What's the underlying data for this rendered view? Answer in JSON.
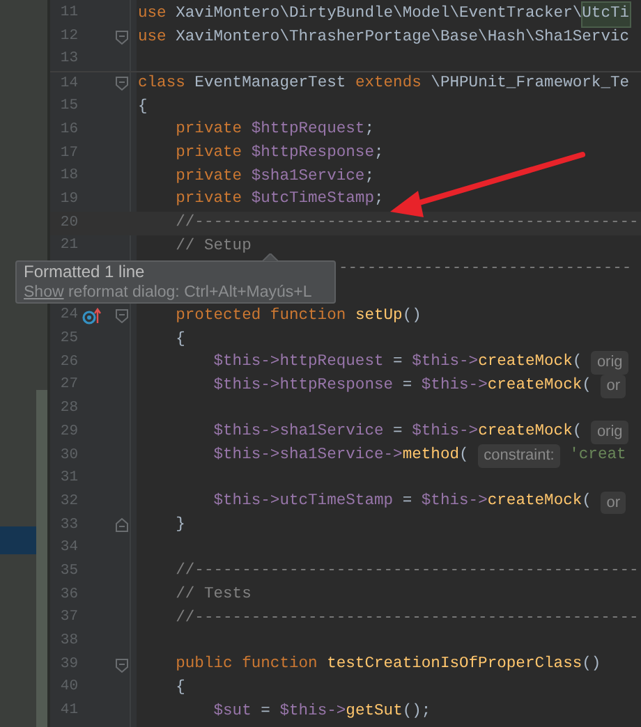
{
  "editor": {
    "lines": [
      {
        "number": "11",
        "segments": [
          {
            "text": "use",
            "kind": "keyword"
          },
          {
            "text": " XaviMontero\\DirtyBundle\\Model\\EventTracker\\",
            "kind": "plain"
          },
          {
            "text": "UtcTi",
            "kind": "usage"
          }
        ]
      },
      {
        "number": "12",
        "fold_start": true,
        "segments": [
          {
            "text": "use",
            "kind": "keyword"
          },
          {
            "text": " XaviMontero\\ThrasherPortage\\Base\\Hash\\Sha1Servic",
            "kind": "plain"
          }
        ]
      },
      {
        "number": "13",
        "separator": true
      },
      {
        "number": "14",
        "fold_start": true,
        "segments": [
          {
            "text": "class",
            "kind": "keyword"
          },
          {
            "text": " EventManagerTest ",
            "kind": "plain"
          },
          {
            "text": "extends",
            "kind": "keyword"
          },
          {
            "text": " \\PHPUnit_Framework_Te",
            "kind": "plain"
          }
        ]
      },
      {
        "number": "15",
        "segments": [
          {
            "text": "{",
            "kind": "plain"
          }
        ]
      },
      {
        "number": "16",
        "segments": [
          {
            "text": "    private",
            "kind": "keyword"
          },
          {
            "text": " $httpRequest",
            "kind": "variable"
          },
          {
            "text": ";",
            "kind": "plain"
          }
        ]
      },
      {
        "number": "17",
        "segments": [
          {
            "text": "    private",
            "kind": "keyword"
          },
          {
            "text": " $httpResponse",
            "kind": "variable"
          },
          {
            "text": ";",
            "kind": "plain"
          }
        ]
      },
      {
        "number": "18",
        "segments": [
          {
            "text": "    private",
            "kind": "keyword"
          },
          {
            "text": " $sha1Service",
            "kind": "variable"
          },
          {
            "text": ";",
            "kind": "plain"
          }
        ]
      },
      {
        "number": "19",
        "segments": [
          {
            "text": "    private",
            "kind": "keyword"
          },
          {
            "text": " $utcTimeStamp",
            "kind": "variable"
          },
          {
            "text": ";",
            "kind": "plain"
          }
        ]
      },
      {
        "number": "20",
        "current": true,
        "segments": [
          {
            "text": "    //-----------------------------------------------",
            "kind": "comment"
          }
        ]
      },
      {
        "number": "21",
        "segments": [
          {
            "text": "    // Setup",
            "kind": "comment"
          }
        ]
      },
      {
        "segments": [
          {
            "text": "-------------------------------",
            "kind": "comment"
          }
        ]
      },
      {
        "number": "24",
        "override": true,
        "fold_start": true,
        "segments": [
          {
            "text": "    protected function ",
            "kind": "keyword"
          },
          {
            "text": "setUp",
            "kind": "function"
          },
          {
            "text": "()",
            "kind": "plain"
          }
        ]
      },
      {
        "number": "25",
        "segments": [
          {
            "text": "    {",
            "kind": "plain"
          }
        ]
      },
      {
        "number": "26",
        "segments": [
          {
            "text": "        $this->httpRequest",
            "kind": "variable"
          },
          {
            "text": " = ",
            "kind": "plain"
          },
          {
            "text": "$this->",
            "kind": "variable"
          },
          {
            "text": "createMock",
            "kind": "function"
          },
          {
            "text": "( ",
            "kind": "plain"
          },
          {
            "text": "orig",
            "kind": "hint"
          }
        ]
      },
      {
        "number": "27",
        "segments": [
          {
            "text": "        $this->httpResponse",
            "kind": "variable"
          },
          {
            "text": " = ",
            "kind": "plain"
          },
          {
            "text": "$this->",
            "kind": "variable"
          },
          {
            "text": "createMock",
            "kind": "function"
          },
          {
            "text": "( ",
            "kind": "plain"
          },
          {
            "text": "or",
            "kind": "hint"
          }
        ]
      },
      {
        "number": "28"
      },
      {
        "number": "29",
        "segments": [
          {
            "text": "        $this->sha1Service",
            "kind": "variable"
          },
          {
            "text": " = ",
            "kind": "plain"
          },
          {
            "text": "$this->",
            "kind": "variable"
          },
          {
            "text": "createMock",
            "kind": "function"
          },
          {
            "text": "( ",
            "kind": "plain"
          },
          {
            "text": "orig",
            "kind": "hint"
          }
        ]
      },
      {
        "number": "30",
        "segments": [
          {
            "text": "        $this->sha1Service->",
            "kind": "variable"
          },
          {
            "text": "method",
            "kind": "function"
          },
          {
            "text": "( ",
            "kind": "plain"
          },
          {
            "text": "constraint:",
            "kind": "hint"
          },
          {
            "text": " 'creat",
            "kind": "string"
          }
        ]
      },
      {
        "number": "31"
      },
      {
        "number": "32",
        "segments": [
          {
            "text": "        $this->utcTimeStamp",
            "kind": "variable"
          },
          {
            "text": " = ",
            "kind": "plain"
          },
          {
            "text": "$this->",
            "kind": "variable"
          },
          {
            "text": "createMock",
            "kind": "function"
          },
          {
            "text": "( ",
            "kind": "plain"
          },
          {
            "text": "or",
            "kind": "hint"
          }
        ]
      },
      {
        "number": "33",
        "fold_end": true,
        "segments": [
          {
            "text": "    }",
            "kind": "plain"
          }
        ]
      },
      {
        "number": "34"
      },
      {
        "number": "35",
        "segments": [
          {
            "text": "    //-----------------------------------------------",
            "kind": "comment"
          }
        ]
      },
      {
        "number": "36",
        "segments": [
          {
            "text": "    // Tests",
            "kind": "comment"
          }
        ]
      },
      {
        "number": "37",
        "segments": [
          {
            "text": "    //-----------------------------------------------",
            "kind": "comment"
          }
        ]
      },
      {
        "number": "38"
      },
      {
        "number": "39",
        "fold_start": true,
        "segments": [
          {
            "text": "    public function ",
            "kind": "keyword"
          },
          {
            "text": "testCreationIsOfProperClass",
            "kind": "function"
          },
          {
            "text": "()",
            "kind": "plain"
          }
        ]
      },
      {
        "number": "40",
        "segments": [
          {
            "text": "    {",
            "kind": "plain"
          }
        ]
      },
      {
        "number": "41",
        "segments": [
          {
            "text": "        $sut",
            "kind": "variable"
          },
          {
            "text": " = ",
            "kind": "plain"
          },
          {
            "text": "$this->",
            "kind": "variable"
          },
          {
            "text": "getSut",
            "kind": "function"
          },
          {
            "text": "();",
            "kind": "plain"
          }
        ]
      }
    ]
  },
  "tooltip": {
    "title": "Formatted 1 line",
    "link": "Show",
    "text": " reformat dialog: Ctrl+Alt+Mayús+L"
  }
}
